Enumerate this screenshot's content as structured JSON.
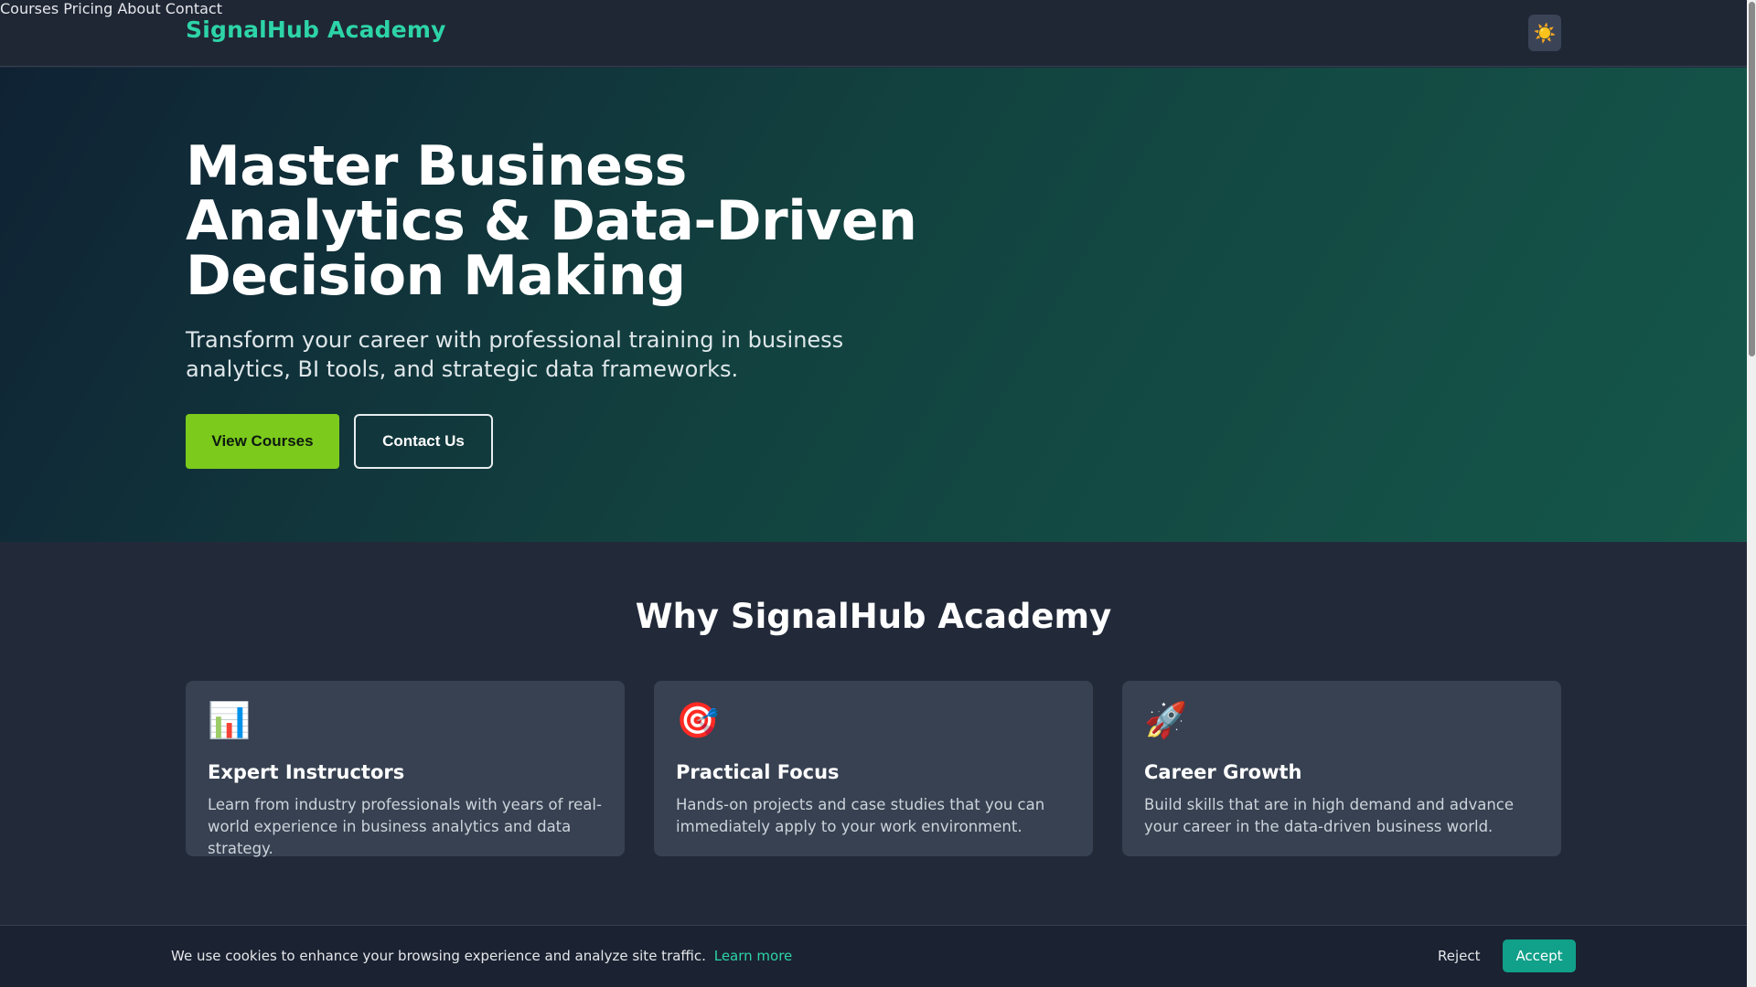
{
  "header": {
    "brand": "SignalHub Academy",
    "nav": [
      "Courses",
      "Pricing",
      "About",
      "Contact"
    ],
    "theme_toggle_icon": "☀️"
  },
  "hero": {
    "title": "Master Business Analytics & Data-Driven Decision Making",
    "subtitle": "Transform your career with professional training in business analytics, BI tools, and strategic data frameworks.",
    "primary_button": "View Courses",
    "secondary_button": "Contact Us"
  },
  "why": {
    "title": "Why SignalHub Academy",
    "cards": [
      {
        "icon": "📊",
        "icon_name": "bar-chart-icon",
        "title": "Expert Instructors",
        "text": "Learn from industry professionals with years of real-world experience in business analytics and data strategy."
      },
      {
        "icon": "🎯",
        "icon_name": "target-icon",
        "title": "Practical Focus",
        "text": "Hands-on projects and case studies that you can immediately apply to your work environment."
      },
      {
        "icon": "🚀",
        "icon_name": "rocket-icon",
        "title": "Career Growth",
        "text": "Build skills that are in high demand and advance your career in the data-driven business world."
      }
    ]
  },
  "cookie_banner": {
    "text": "We use cookies to enhance your browsing experience and analyze site traffic.",
    "link": "Learn more",
    "reject": "Reject",
    "accept": "Accept"
  },
  "colors": {
    "brand": "#2dd4a7",
    "primary_button": "#7ccb1c",
    "accept_button": "#11a08a"
  }
}
